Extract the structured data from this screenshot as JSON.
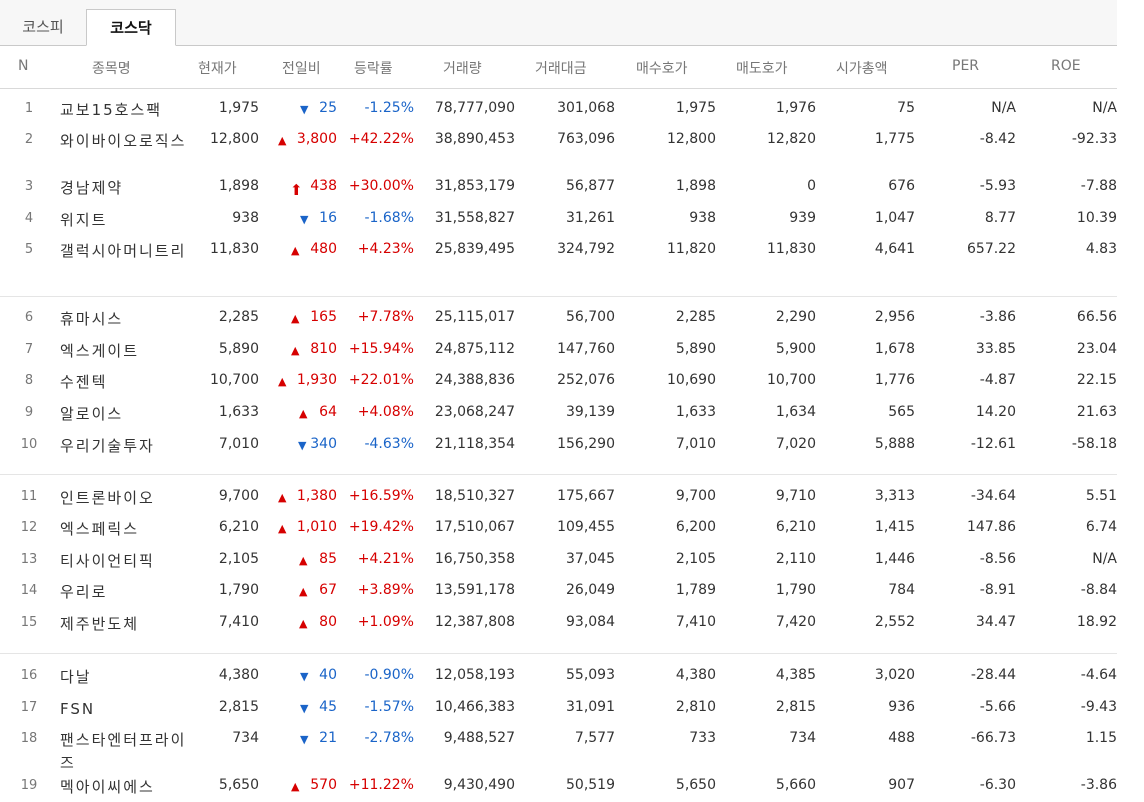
{
  "tabs": [
    {
      "label": "코스피",
      "active": false
    },
    {
      "label": "코스닥",
      "active": true
    }
  ],
  "columns": [
    "N",
    "종목명",
    "현재가",
    "전일비",
    "등락률",
    "거래량",
    "거래대금",
    "매수호가",
    "매도호가",
    "시가총액",
    "PER",
    "ROE"
  ],
  "colors": {
    "up": "#d60000",
    "down": "#1a64c8"
  },
  "rows": [
    {
      "n": "1",
      "name": "교보15호스팩",
      "price": "1,975",
      "dir": "down",
      "icon": "triangle-down-icon",
      "chg": "25",
      "rate": "-1.25%",
      "vol": "78,777,090",
      "amt": "301,068",
      "bid": "1,975",
      "ask": "1,976",
      "cap": "75",
      "per": "N/A",
      "roe": "N/A"
    },
    {
      "n": "2",
      "name": "와이바이오로직스",
      "price": "12,800",
      "dir": "up",
      "icon": "triangle-up-icon",
      "chg": "3,800",
      "rate": "+42.22%",
      "vol": "38,890,453",
      "amt": "763,096",
      "bid": "12,800",
      "ask": "12,820",
      "cap": "1,775",
      "per": "-8.42",
      "roe": "-92.33"
    },
    {
      "n": "3",
      "name": "경남제약",
      "price": "1,898",
      "dir": "up",
      "icon": "upper-limit-arrow-icon",
      "chg": "438",
      "rate": "+30.00%",
      "vol": "31,853,179",
      "amt": "56,877",
      "bid": "1,898",
      "ask": "0",
      "cap": "676",
      "per": "-5.93",
      "roe": "-7.88"
    },
    {
      "n": "4",
      "name": "위지트",
      "price": "938",
      "dir": "down",
      "icon": "triangle-down-icon",
      "chg": "16",
      "rate": "-1.68%",
      "vol": "31,558,827",
      "amt": "31,261",
      "bid": "938",
      "ask": "939",
      "cap": "1,047",
      "per": "8.77",
      "roe": "10.39"
    },
    {
      "n": "5",
      "name": "갤럭시아머니트리",
      "price": "11,830",
      "dir": "up",
      "icon": "triangle-up-icon",
      "chg": "480",
      "rate": "+4.23%",
      "vol": "25,839,495",
      "amt": "324,792",
      "bid": "11,820",
      "ask": "11,830",
      "cap": "4,641",
      "per": "657.22",
      "roe": "4.83"
    },
    {
      "n": "6",
      "name": "휴마시스",
      "price": "2,285",
      "dir": "up",
      "icon": "triangle-up-icon",
      "chg": "165",
      "rate": "+7.78%",
      "vol": "25,115,017",
      "amt": "56,700",
      "bid": "2,285",
      "ask": "2,290",
      "cap": "2,956",
      "per": "-3.86",
      "roe": "66.56"
    },
    {
      "n": "7",
      "name": "엑스게이트",
      "price": "5,890",
      "dir": "up",
      "icon": "triangle-up-icon",
      "chg": "810",
      "rate": "+15.94%",
      "vol": "24,875,112",
      "amt": "147,760",
      "bid": "5,890",
      "ask": "5,900",
      "cap": "1,678",
      "per": "33.85",
      "roe": "23.04"
    },
    {
      "n": "8",
      "name": "수젠텍",
      "price": "10,700",
      "dir": "up",
      "icon": "triangle-up-icon",
      "chg": "1,930",
      "rate": "+22.01%",
      "vol": "24,388,836",
      "amt": "252,076",
      "bid": "10,690",
      "ask": "10,700",
      "cap": "1,776",
      "per": "-4.87",
      "roe": "22.15"
    },
    {
      "n": "9",
      "name": "알로이스",
      "price": "1,633",
      "dir": "up",
      "icon": "triangle-up-icon",
      "chg": "64",
      "rate": "+4.08%",
      "vol": "23,068,247",
      "amt": "39,139",
      "bid": "1,633",
      "ask": "1,634",
      "cap": "565",
      "per": "14.20",
      "roe": "21.63"
    },
    {
      "n": "10",
      "name": "우리기술투자",
      "price": "7,010",
      "dir": "down",
      "icon": "triangle-down-icon",
      "chg": "340",
      "rate": "-4.63%",
      "vol": "21,118,354",
      "amt": "156,290",
      "bid": "7,010",
      "ask": "7,020",
      "cap": "5,888",
      "per": "-12.61",
      "roe": "-58.18"
    },
    {
      "n": "11",
      "name": "인트론바이오",
      "price": "9,700",
      "dir": "up",
      "icon": "triangle-up-icon",
      "chg": "1,380",
      "rate": "+16.59%",
      "vol": "18,510,327",
      "amt": "175,667",
      "bid": "9,700",
      "ask": "9,710",
      "cap": "3,313",
      "per": "-34.64",
      "roe": "5.51"
    },
    {
      "n": "12",
      "name": "엑스페릭스",
      "price": "6,210",
      "dir": "up",
      "icon": "triangle-up-icon",
      "chg": "1,010",
      "rate": "+19.42%",
      "vol": "17,510,067",
      "amt": "109,455",
      "bid": "6,200",
      "ask": "6,210",
      "cap": "1,415",
      "per": "147.86",
      "roe": "6.74"
    },
    {
      "n": "13",
      "name": "티사이언티픽",
      "price": "2,105",
      "dir": "up",
      "icon": "triangle-up-icon",
      "chg": "85",
      "rate": "+4.21%",
      "vol": "16,750,358",
      "amt": "37,045",
      "bid": "2,105",
      "ask": "2,110",
      "cap": "1,446",
      "per": "-8.56",
      "roe": "N/A"
    },
    {
      "n": "14",
      "name": "우리로",
      "price": "1,790",
      "dir": "up",
      "icon": "triangle-up-icon",
      "chg": "67",
      "rate": "+3.89%",
      "vol": "13,591,178",
      "amt": "26,049",
      "bid": "1,789",
      "ask": "1,790",
      "cap": "784",
      "per": "-8.91",
      "roe": "-8.84"
    },
    {
      "n": "15",
      "name": "제주반도체",
      "price": "7,410",
      "dir": "up",
      "icon": "triangle-up-icon",
      "chg": "80",
      "rate": "+1.09%",
      "vol": "12,387,808",
      "amt": "93,084",
      "bid": "7,410",
      "ask": "7,420",
      "cap": "2,552",
      "per": "34.47",
      "roe": "18.92"
    },
    {
      "n": "16",
      "name": "다날",
      "price": "4,380",
      "dir": "down",
      "icon": "triangle-down-icon",
      "chg": "40",
      "rate": "-0.90%",
      "vol": "12,058,193",
      "amt": "55,093",
      "bid": "4,380",
      "ask": "4,385",
      "cap": "3,020",
      "per": "-28.44",
      "roe": "-4.64"
    },
    {
      "n": "17",
      "name": "FSN",
      "price": "2,815",
      "dir": "down",
      "icon": "triangle-down-icon",
      "chg": "45",
      "rate": "-1.57%",
      "vol": "10,466,383",
      "amt": "31,091",
      "bid": "2,810",
      "ask": "2,815",
      "cap": "936",
      "per": "-5.66",
      "roe": "-9.43"
    },
    {
      "n": "18",
      "name": "팬스타엔터프라이즈",
      "price": "734",
      "dir": "down",
      "icon": "triangle-down-icon",
      "chg": "21",
      "rate": "-2.78%",
      "vol": "9,488,527",
      "amt": "7,577",
      "bid": "733",
      "ask": "734",
      "cap": "488",
      "per": "-66.73",
      "roe": "1.15"
    },
    {
      "n": "19",
      "name": "멕아이씨에스",
      "price": "5,650",
      "dir": "up",
      "icon": "triangle-up-icon",
      "chg": "570",
      "rate": "+11.22%",
      "vol": "9,430,490",
      "amt": "50,519",
      "bid": "5,650",
      "ask": "5,660",
      "cap": "907",
      "per": "-6.30",
      "roe": "-3.86"
    }
  ]
}
